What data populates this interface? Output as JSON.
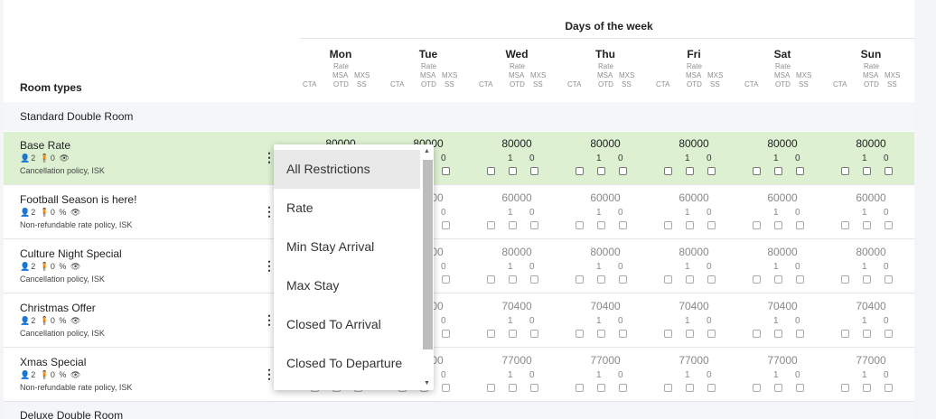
{
  "header": {
    "days_of_week_title": "Days of the week",
    "room_types_title": "Room types"
  },
  "days": [
    "Mon",
    "Tue",
    "Wed",
    "Thu",
    "Fri",
    "Sat",
    "Sun"
  ],
  "sublabels": {
    "rate": "Rate",
    "msa": "MSA",
    "otd": "OTD",
    "mxs": "MXS",
    "ss": "SS",
    "cta": "CTA"
  },
  "sections": [
    {
      "title": "Standard Double Room"
    },
    {
      "title": "Deluxe Double Room"
    }
  ],
  "rows": [
    {
      "name": "Base Rate",
      "icons": "👤2 🧍0 👁",
      "policy": "Cancellation policy,  ISK",
      "rate": "80000",
      "msa": "1",
      "mxs": "0"
    },
    {
      "name": "Football Season is here!",
      "icons": "👤2 🧍0 % 👁",
      "policy": "Non-refundable rate policy,  ISK",
      "rate": "60000",
      "msa": "1",
      "mxs": "0"
    },
    {
      "name": "Culture Night Special",
      "icons": "👤2 🧍0 % 👁",
      "policy": "Cancellation policy,  ISK",
      "rate": "80000",
      "msa": "1",
      "mxs": "0"
    },
    {
      "name": "Christmas Offer",
      "icons": "👤2 🧍0 % 👁",
      "policy": "Cancellation policy,  ISK",
      "rate": "70400",
      "msa": "1",
      "mxs": "0"
    },
    {
      "name": "Xmas Special",
      "icons": "👤2 🧍0 % 👁",
      "policy": "Non-refundable rate policy,  ISK",
      "rate": "77000",
      "msa": "1",
      "mxs": "0"
    }
  ],
  "dropdown": {
    "items": [
      "All Restrictions",
      "Rate",
      "Min Stay Arrival",
      "Max Stay",
      "Closed To Arrival",
      "Closed To Departure"
    ],
    "selected": "All Restrictions"
  },
  "colors": {
    "highlight_row": "#ddf0d2",
    "section_bg": "#f4f6fa"
  }
}
